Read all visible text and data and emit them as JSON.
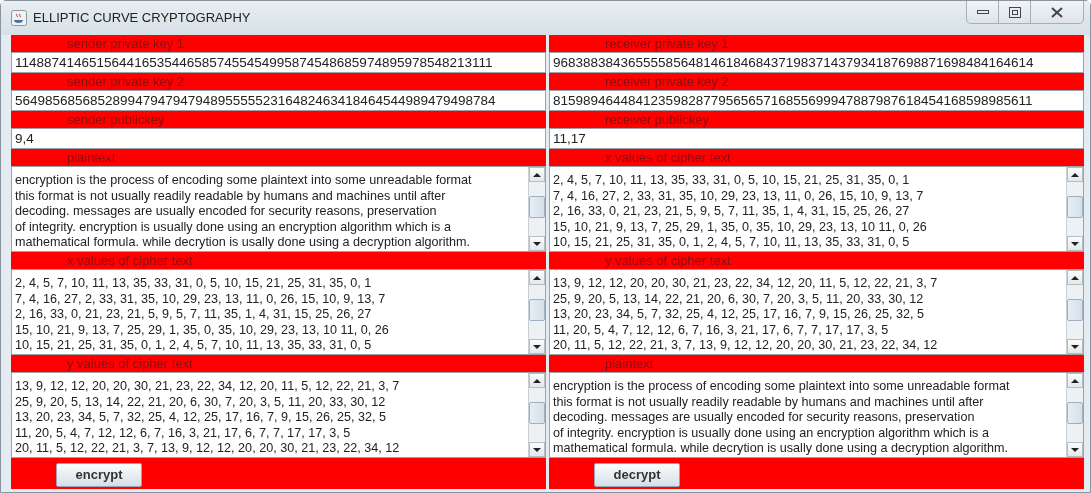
{
  "window": {
    "title": "ELLIPTIC CURVE CRYPTOGRAPHY"
  },
  "panels": [
    {
      "fields": [
        {
          "kind": "line",
          "label": "sender private key 1",
          "value": "1148874146515644165354465857455454995874548685974895978548213111"
        },
        {
          "kind": "line",
          "label": "sender private key 2",
          "value": "5649856856852899479479479489555552316482463418464544989479498784"
        },
        {
          "kind": "line",
          "label": "sender publickey",
          "value": "9,4"
        },
        {
          "kind": "area",
          "label": "plaintext",
          "lines": [
            "encryption is the process of encoding some plaintext into some unreadable format",
            "this format is not usually readily readable by humans and machines until after",
            "decoding. messages are usually encoded for security reasons, preservation",
            "of integrity. encryption is usually done using an encryption algorithm which is a",
            "mathematical formula. while decrytion is usally done using a decryption algorithm."
          ]
        },
        {
          "kind": "area",
          "label": "x values of cipher text",
          "lines": [
            "2, 4, 5, 7, 10, 11, 13, 35, 33, 31, 0, 5, 10, 15, 21, 25, 31, 35, 0, 1",
            "7, 4, 16, 27, 2, 33, 31, 35, 10, 29, 23, 13, 11, 0, 26, 15, 10, 9, 13, 7",
            "2, 16, 33, 0, 21, 23, 21, 5, 9, 5, 7, 11, 35, 1, 4, 31, 15, 25, 26, 27",
            "15, 10, 21, 9, 13, 7, 25, 29, 1, 35, 0, 35, 10, 29, 23, 13, 10 11, 0, 26",
            "10, 15, 21, 25, 31, 35, 0, 1, 2, 4, 5, 7, 10, 11, 13, 35, 33, 31, 0, 5"
          ]
        },
        {
          "kind": "area",
          "label": "y values of cipher text",
          "lines": [
            "13, 9, 12, 12, 20, 20, 30, 21, 23, 22, 34, 12, 20, 11, 5, 12, 22, 21, 3, 7",
            "25, 9, 20, 5, 13, 14, 22, 21, 20, 6, 30, 7, 20, 3, 5, 11, 20, 33, 30, 12",
            "13, 20, 23, 34, 5, 7, 32, 25, 4, 12, 25, 17, 16, 7, 9, 15, 26, 25, 32, 5",
            "11, 20, 5, 4, 7, 12, 12, 6, 7, 16, 3, 21, 17, 6, 7, 7, 17, 17, 3, 5",
            "20, 11, 5, 12, 22, 21, 3, 7, 13, 9, 12, 12, 20, 20, 30, 21, 23, 22, 34, 12"
          ]
        }
      ],
      "button": "encrypt"
    },
    {
      "fields": [
        {
          "kind": "line",
          "label": "receiver private key 1",
          "value": "9683883843655558564814618468437198371437934187698871698484164614"
        },
        {
          "kind": "line",
          "label": "receiver private key 2",
          "value": "8159894644841235982877956565716855699947887987618454168598985611"
        },
        {
          "kind": "line",
          "label": "receiver publickey",
          "value": "11,17"
        },
        {
          "kind": "area",
          "label": "x values of cipher text",
          "lines": [
            "2, 4, 5, 7, 10, 11, 13, 35, 33, 31, 0, 5, 10, 15, 21, 25, 31, 35, 0, 1",
            "7, 4, 16, 27, 2, 33, 31, 35, 10, 29, 23, 13, 11, 0, 26, 15, 10, 9, 13, 7",
            "2, 16, 33, 0, 21, 23, 21, 5, 9, 5, 7, 11, 35, 1, 4, 31, 15, 25, 26, 27",
            "15, 10, 21, 9, 13, 7, 25, 29, 1, 35, 0, 35, 10, 29, 23, 13, 10 11, 0, 26",
            "10, 15, 21, 25, 31, 35, 0, 1, 2, 4, 5, 7, 10, 11, 13, 35, 33, 31, 0, 5"
          ]
        },
        {
          "kind": "area",
          "label": "y values of cipher text",
          "lines": [
            "13, 9, 12, 12, 20, 20, 30, 21, 23, 22, 34, 12, 20, 11, 5, 12, 22, 21, 3, 7",
            "25, 9, 20, 5, 13, 14, 22, 21, 20, 6, 30, 7, 20, 3, 5, 11, 20, 33, 30, 12",
            "13, 20, 23, 34, 5, 7, 32, 25, 4, 12, 25, 17, 16, 7, 9, 15, 26, 25, 32, 5",
            "11, 20, 5, 4, 7, 12, 12, 6, 7, 16, 3, 21, 17, 6, 7, 7, 17, 17, 3, 5",
            "20, 11, 5, 12, 22, 21, 3, 7, 13, 9, 12, 12, 20, 20, 30, 21, 23, 22, 34, 12"
          ]
        },
        {
          "kind": "area",
          "label": "plaintext",
          "lines": [
            "encryption is the process of encoding some plaintext into some unreadable format",
            "this format is not usually readily readable by humans and machines until after",
            "decoding. messages are usually encoded for security reasons, preservation",
            "of integrity. encryption is usually done using an encryption algorithm which is a",
            "mathematical formula. while decrytion is usally done using a decryption algorithm."
          ]
        }
      ],
      "button": "decrypt"
    }
  ]
}
